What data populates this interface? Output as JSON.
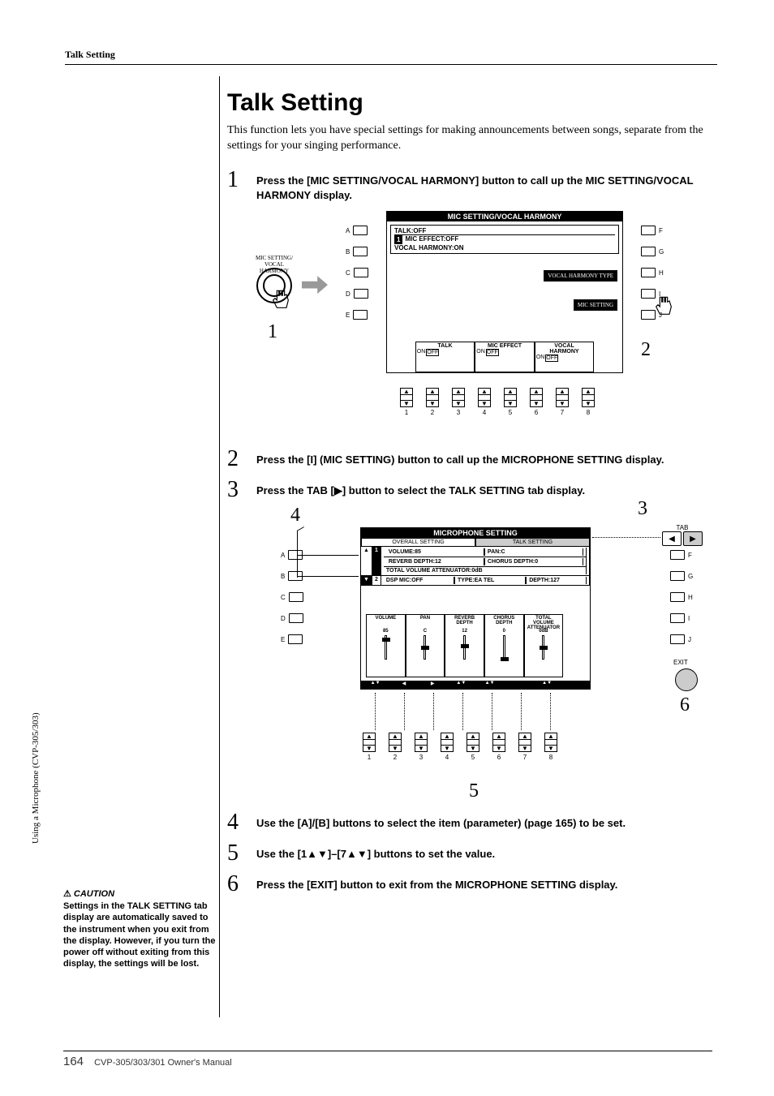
{
  "header": {
    "running_head": "Talk Setting"
  },
  "title": "Talk Setting",
  "intro": "This function lets you have special settings for making announcements between songs, separate from the settings for your singing performance.",
  "steps": [
    {
      "num": "1",
      "text": "Press the [MIC SETTING/VOCAL HARMONY] button to call up the MIC SETTING/VOCAL HARMONY display."
    },
    {
      "num": "2",
      "text": "Press the [I] (MIC SETTING) button to call up the MICROPHONE SETTING display."
    },
    {
      "num": "3",
      "text": "Press the TAB [▶] button to select the TALK SETTING tab display."
    },
    {
      "num": "4",
      "text": "Use the [A]/[B] buttons to select the item (parameter) (page 165) to be set."
    },
    {
      "num": "5",
      "text": "Use the [1▲▼]–[7▲▼] buttons to set the value."
    },
    {
      "num": "6",
      "text": "Press the [EXIT] button to exit from the MICROPHONE SETTING display."
    }
  ],
  "fig1": {
    "dial_label": "MIC SETTING/\nVOCAL HARMONY",
    "callout1": "1",
    "callout2": "2",
    "screen_title": "MIC SETTING/VOCAL HARMONY",
    "left_letters": [
      "A",
      "B",
      "C",
      "D",
      "E"
    ],
    "right_letters": [
      "F",
      "G",
      "H",
      "I",
      "J"
    ],
    "box_lines": [
      "TALK:OFF",
      "MIC EFFECT:OFF",
      "VOCAL HARMONY:ON"
    ],
    "right_btns": [
      "VOCAL HARMONY\nTYPE",
      "MIC SETTING"
    ],
    "foot": [
      {
        "label": "TALK",
        "opts": [
          "ON",
          "OFF"
        ]
      },
      {
        "label": "MIC EFFECT",
        "opts": [
          "ON",
          "OFF"
        ]
      },
      {
        "label": "VOCAL\nHARMONY",
        "opts": [
          "ON",
          "OFF"
        ]
      }
    ],
    "updown_numbers": [
      "1",
      "2",
      "3",
      "4",
      "5",
      "6",
      "7",
      "8"
    ]
  },
  "fig2": {
    "callout3": "3",
    "callout4": "4",
    "callout5": "5",
    "callout6": "6",
    "tab_label": "TAB",
    "exit_label": "EXIT",
    "screen_title": "MICROPHONE SETTING",
    "tabs": [
      "OVERALL SETTING",
      "TALK SETTING"
    ],
    "active_tab": 1,
    "row1": {
      "prefix": "1",
      "cells": [
        "VOLUME:85",
        "PAN:C",
        "REVERB DEPTH:12",
        "CHORUS DEPTH:0",
        "TOTAL VOLUME ATTENUATOR:0dB"
      ]
    },
    "row2": {
      "prefix": "2",
      "cells": [
        "DSP MIC:OFF",
        "TYPE:EA TEL",
        "DEPTH:127"
      ]
    },
    "sliders": [
      {
        "label": "VOLUME",
        "val": "85"
      },
      {
        "label": "PAN",
        "val": "C"
      },
      {
        "label": "REVERB\nDEPTH",
        "val": "12"
      },
      {
        "label": "CHORUS\nDEPTH",
        "val": "0"
      },
      {
        "label": "TOTAL VOLUME\nATTENUATOR",
        "val": "0dB"
      }
    ],
    "bottom_tabs": [
      "▲▼",
      "◀",
      "▶",
      "▲▼",
      "▲▼",
      "",
      "▲▼",
      ""
    ],
    "left_letters": [
      "A",
      "B",
      "C",
      "D",
      "E"
    ],
    "right_letters": [
      "F",
      "G",
      "H",
      "I",
      "J"
    ],
    "updown_numbers": [
      "1",
      "2",
      "3",
      "4",
      "5",
      "6",
      "7",
      "8"
    ]
  },
  "sidebar": {
    "vertical": "Using a Microphone (CVP-305/303)",
    "caution_head": "CAUTION",
    "caution_body": "Settings in the TALK SETTING tab display are automatically saved to the instrument when you exit from the display. However, if you turn the power off without exiting from this display, the settings will be lost."
  },
  "footer": {
    "page": "164",
    "manual": "CVP-305/303/301 Owner's Manual"
  }
}
